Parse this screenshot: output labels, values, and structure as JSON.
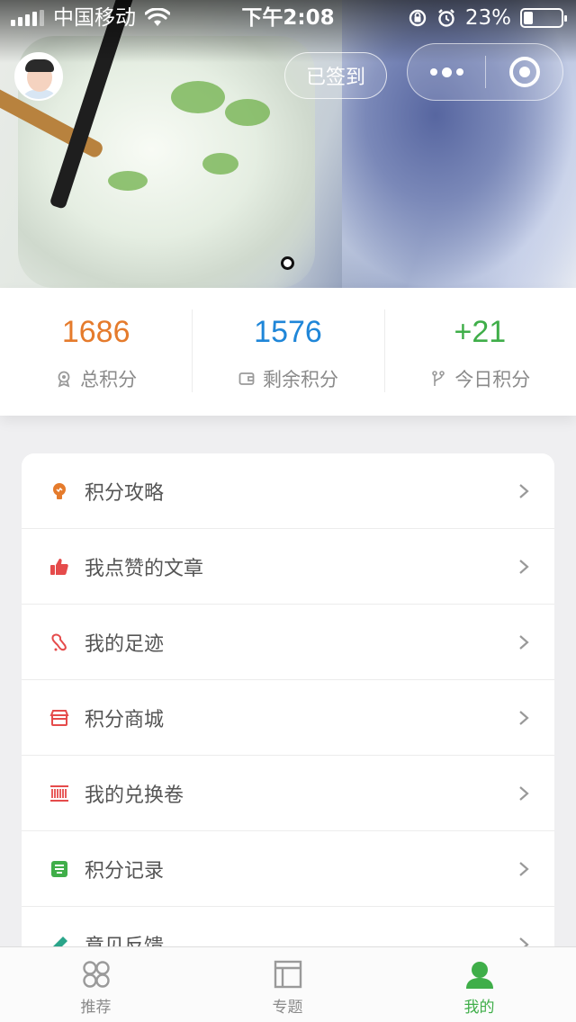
{
  "status_bar": {
    "carrier": "中国移动",
    "time": "下午2:08",
    "battery": "23%",
    "battery_level": 0.23
  },
  "header": {
    "signed_label": "已签到"
  },
  "stats": [
    {
      "value": "1686",
      "label": "总积分",
      "color": "#e57b2c",
      "icon": "badge-icon"
    },
    {
      "value": "1576",
      "label": "剩余积分",
      "color": "#1f86d8",
      "icon": "wallet-icon"
    },
    {
      "value": "+21",
      "label": "今日积分",
      "color": "#3fae49",
      "icon": "branch-icon"
    }
  ],
  "menu": [
    {
      "label": "积分攻略",
      "icon": "lightbulb-icon",
      "color": "#e57b2c"
    },
    {
      "label": "我点赞的文章",
      "icon": "thumbs-up-icon",
      "color": "#e54b4b"
    },
    {
      "label": "我的足迹",
      "icon": "footprint-icon",
      "color": "#e54b4b"
    },
    {
      "label": "积分商城",
      "icon": "store-icon",
      "color": "#e54b4b"
    },
    {
      "label": "我的兑换卷",
      "icon": "barcode-icon",
      "color": "#e54b4b"
    },
    {
      "label": "积分记录",
      "icon": "record-icon",
      "color": "#3fae49"
    },
    {
      "label": "意见反馈",
      "icon": "feedback-icon",
      "color": "#2aa58a"
    }
  ],
  "tabs": [
    {
      "label": "推荐",
      "icon": "recommend-icon",
      "active": false
    },
    {
      "label": "专题",
      "icon": "topics-icon",
      "active": false
    },
    {
      "label": "我的",
      "icon": "profile-icon",
      "active": true
    }
  ]
}
